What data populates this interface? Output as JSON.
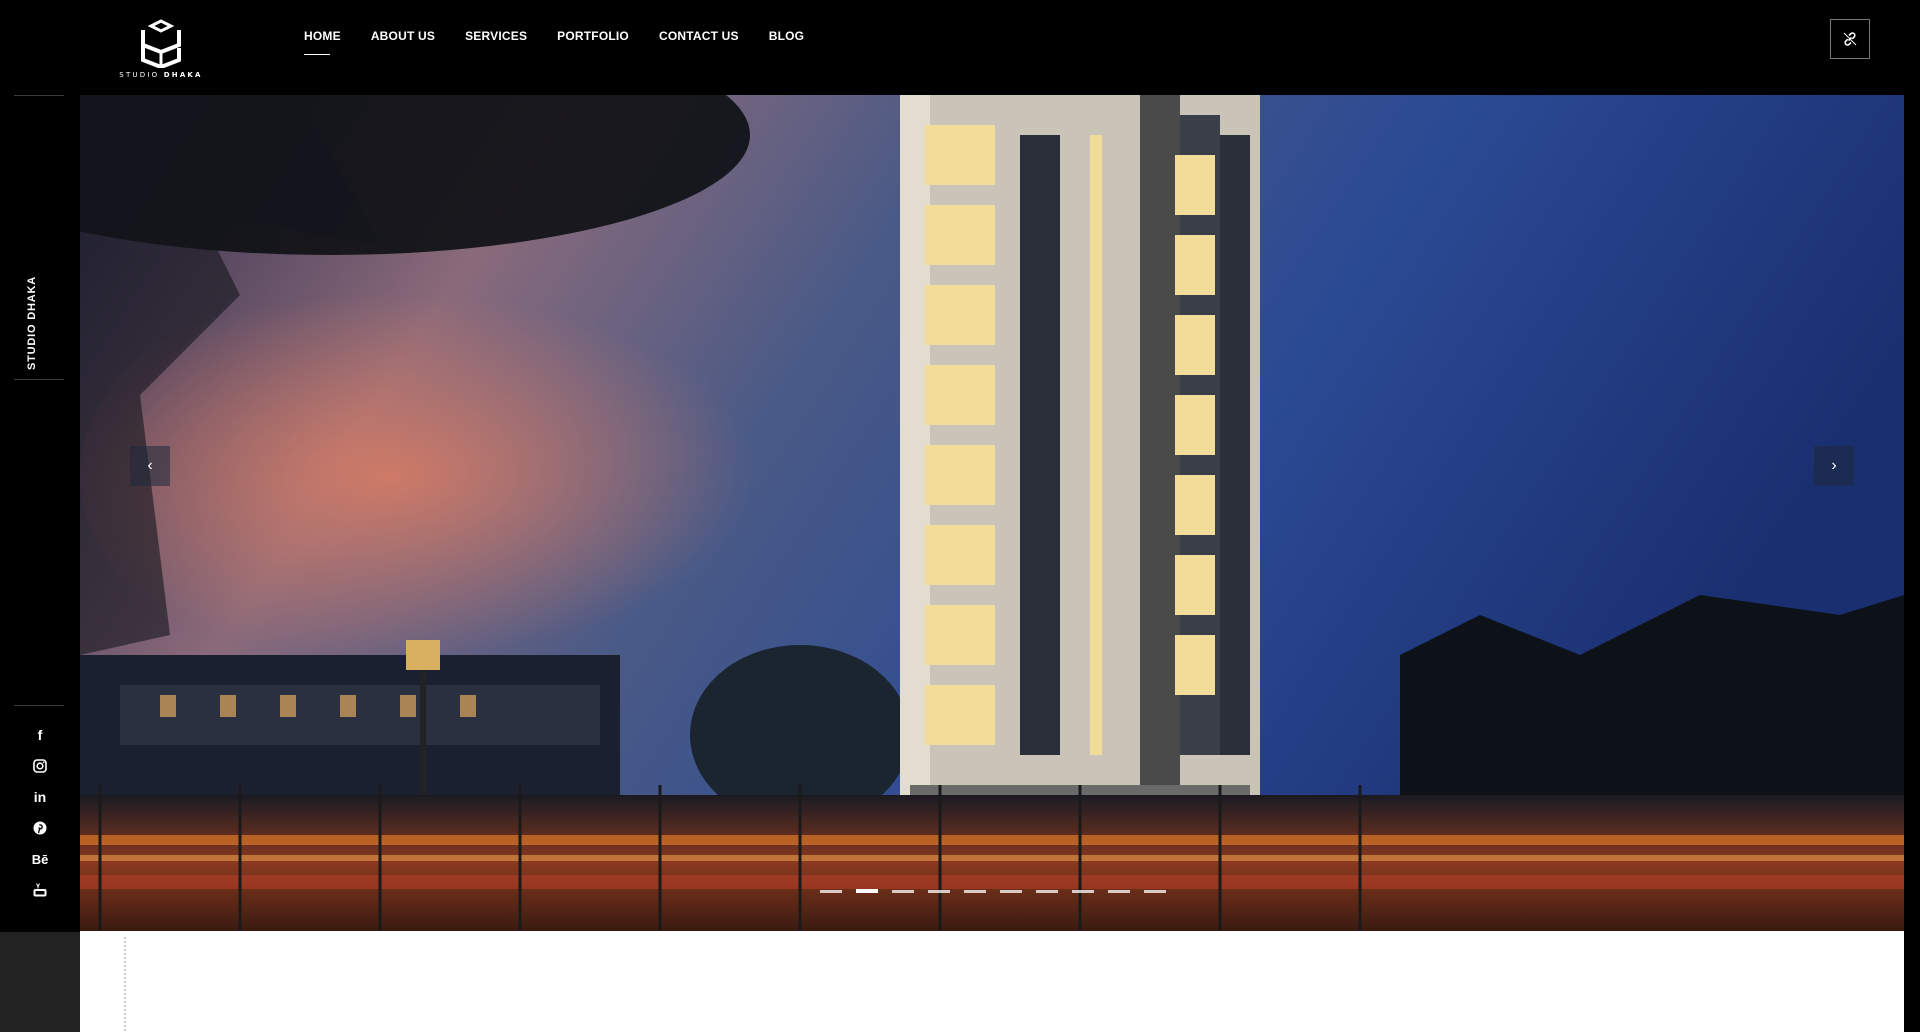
{
  "brand": {
    "logo_text_light": "STUDIO",
    "logo_text_bold": "DHAKA"
  },
  "nav": {
    "items": [
      {
        "label": "HOME",
        "active": true
      },
      {
        "label": "ABOUT US"
      },
      {
        "label": "SERVICES"
      },
      {
        "label": "PORTFOLIO"
      },
      {
        "label": "CONTACT US"
      },
      {
        "label": "BLOG"
      }
    ]
  },
  "header": {
    "action_icon": "link-icon"
  },
  "sidebar": {
    "vertical_label": "STUDIO DHAKA",
    "social": [
      {
        "name": "facebook-icon",
        "glyph": "f"
      },
      {
        "name": "instagram-icon"
      },
      {
        "name": "linkedin-icon",
        "glyph": "in"
      },
      {
        "name": "pinterest-icon"
      },
      {
        "name": "behance-icon",
        "glyph": "Bē"
      },
      {
        "name": "youtube-icon"
      }
    ]
  },
  "slider": {
    "prev_icon": "chevron-left-icon",
    "next_icon": "chevron-right-icon",
    "prev_glyph": "‹",
    "next_glyph": "›",
    "slide_count": 10,
    "active_slide": 2
  },
  "colors": {
    "background": "#000000",
    "content": "#ffffff"
  }
}
